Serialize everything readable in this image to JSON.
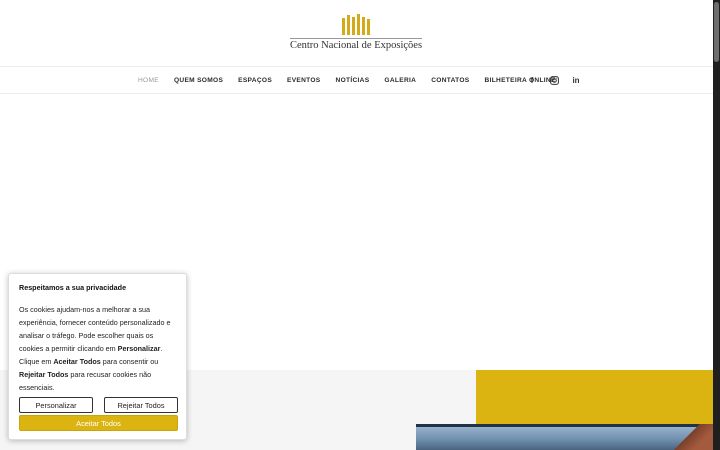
{
  "brand": {
    "name": "Centro Nacional de Exposições",
    "accent_color": "#dbb411"
  },
  "nav": {
    "items": [
      {
        "label": "HOME",
        "active": true
      },
      {
        "label": "QUEM SOMOS"
      },
      {
        "label": "ESPAÇOS"
      },
      {
        "label": "EVENTOS"
      },
      {
        "label": "NOTÍCIAS"
      },
      {
        "label": "GALERIA"
      },
      {
        "label": "CONTATOS"
      },
      {
        "label": "BILHETEIRA ONLINE"
      }
    ],
    "social": [
      {
        "icon": "facebook-icon",
        "glyph": "f"
      },
      {
        "icon": "instagram-icon",
        "glyph": ""
      },
      {
        "icon": "linkedin-icon",
        "glyph": "in"
      }
    ]
  },
  "cookie": {
    "title": "Respeitamos a sua privacidade",
    "text_1": "Os cookies ajudam-nos a melhorar a sua experiência, fornecer conteúdo personalizado e analisar o tráfego. Pode escolher quais os cookies a permitir clicando em ",
    "bold_1": "Personalizar",
    "text_2": ". Clique em ",
    "bold_2": "Aceitar Todos",
    "text_3": " para consentir ou ",
    "bold_3": "Rejeitar Todos",
    "text_4": " para recusar cookies não essenciais.",
    "customize_label": "Personalizar",
    "reject_label": "Rejeitar Todos",
    "accept_label": "Aceitar Todos"
  }
}
